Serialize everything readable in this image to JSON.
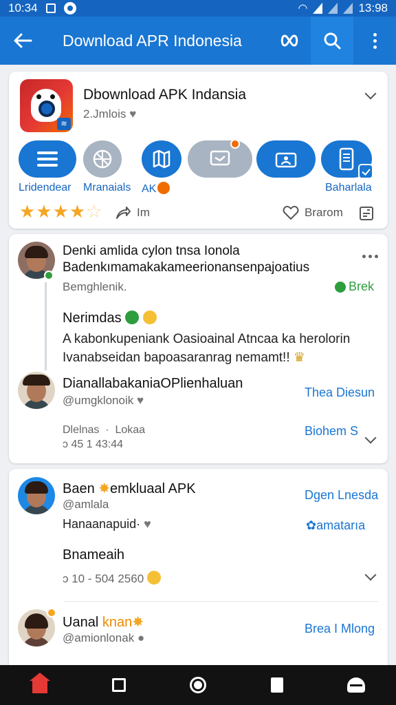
{
  "status_bar": {
    "time": "10:34",
    "clock": "13:98"
  },
  "app_bar": {
    "title": "Download APR Indonesia"
  },
  "app_card": {
    "title": "Dbownload APK Indansia",
    "subtitle": "2.Jmlois",
    "actions": [
      {
        "label": "Lridendear",
        "icon": "menu-lines-icon"
      },
      {
        "label": "Mranaials",
        "icon": "globe-icon"
      },
      {
        "label": "AK",
        "icon": "map-icon"
      },
      {
        "label": "",
        "icon": "message-icon"
      },
      {
        "label": "",
        "icon": "profile-card-icon"
      },
      {
        "label": "Baharlala",
        "icon": "device-icon"
      }
    ],
    "rating_stars": 4,
    "rating_max": 5,
    "share_label": "Im",
    "save_label": "Brarom"
  },
  "post1": {
    "name": "Denki amlida cylon tnsa Ionola",
    "name2": "Badenkımamakakameerionansenpajoatius",
    "handle": "Bemghlenik.",
    "badge": "Brek",
    "subhead": "Nerimdas",
    "body1": "A kabonkupeniank Oasioainal Atncaa ka herolorin",
    "body2": "Ivanabseidan bapoasaranrag nemamt!!",
    "reply": {
      "name": "DianallabakaniaOPlienhaluan",
      "handle": "@umgklonoik",
      "link": "Thea Diesun",
      "meta_left": "Dlelnas",
      "meta_sep": "·",
      "meta_right": "Lokaa",
      "link2": "Biohem S",
      "stats": "ↄ 45   1 43:44"
    }
  },
  "post2": {
    "name": "Baen",
    "name_rest": "emkluaal APK",
    "handle": "@amlala",
    "link": "Dgen Lnesda",
    "line": "Hanaanapuid·",
    "link2": "amatarıa",
    "subhead": "Bnameaih",
    "stats": "ↄ 10 - 504 2560"
  },
  "post3": {
    "name": "Uanal",
    "name_accent": "knan",
    "handle": "@amionlonak",
    "link": "Brea I Mlong"
  },
  "colors": {
    "primary": "#1976d2",
    "status_bar": "#1565c0",
    "star": "#f5a623",
    "green": "#2e9d3e",
    "nav_bg": "#121212",
    "home_active": "#e53935"
  }
}
